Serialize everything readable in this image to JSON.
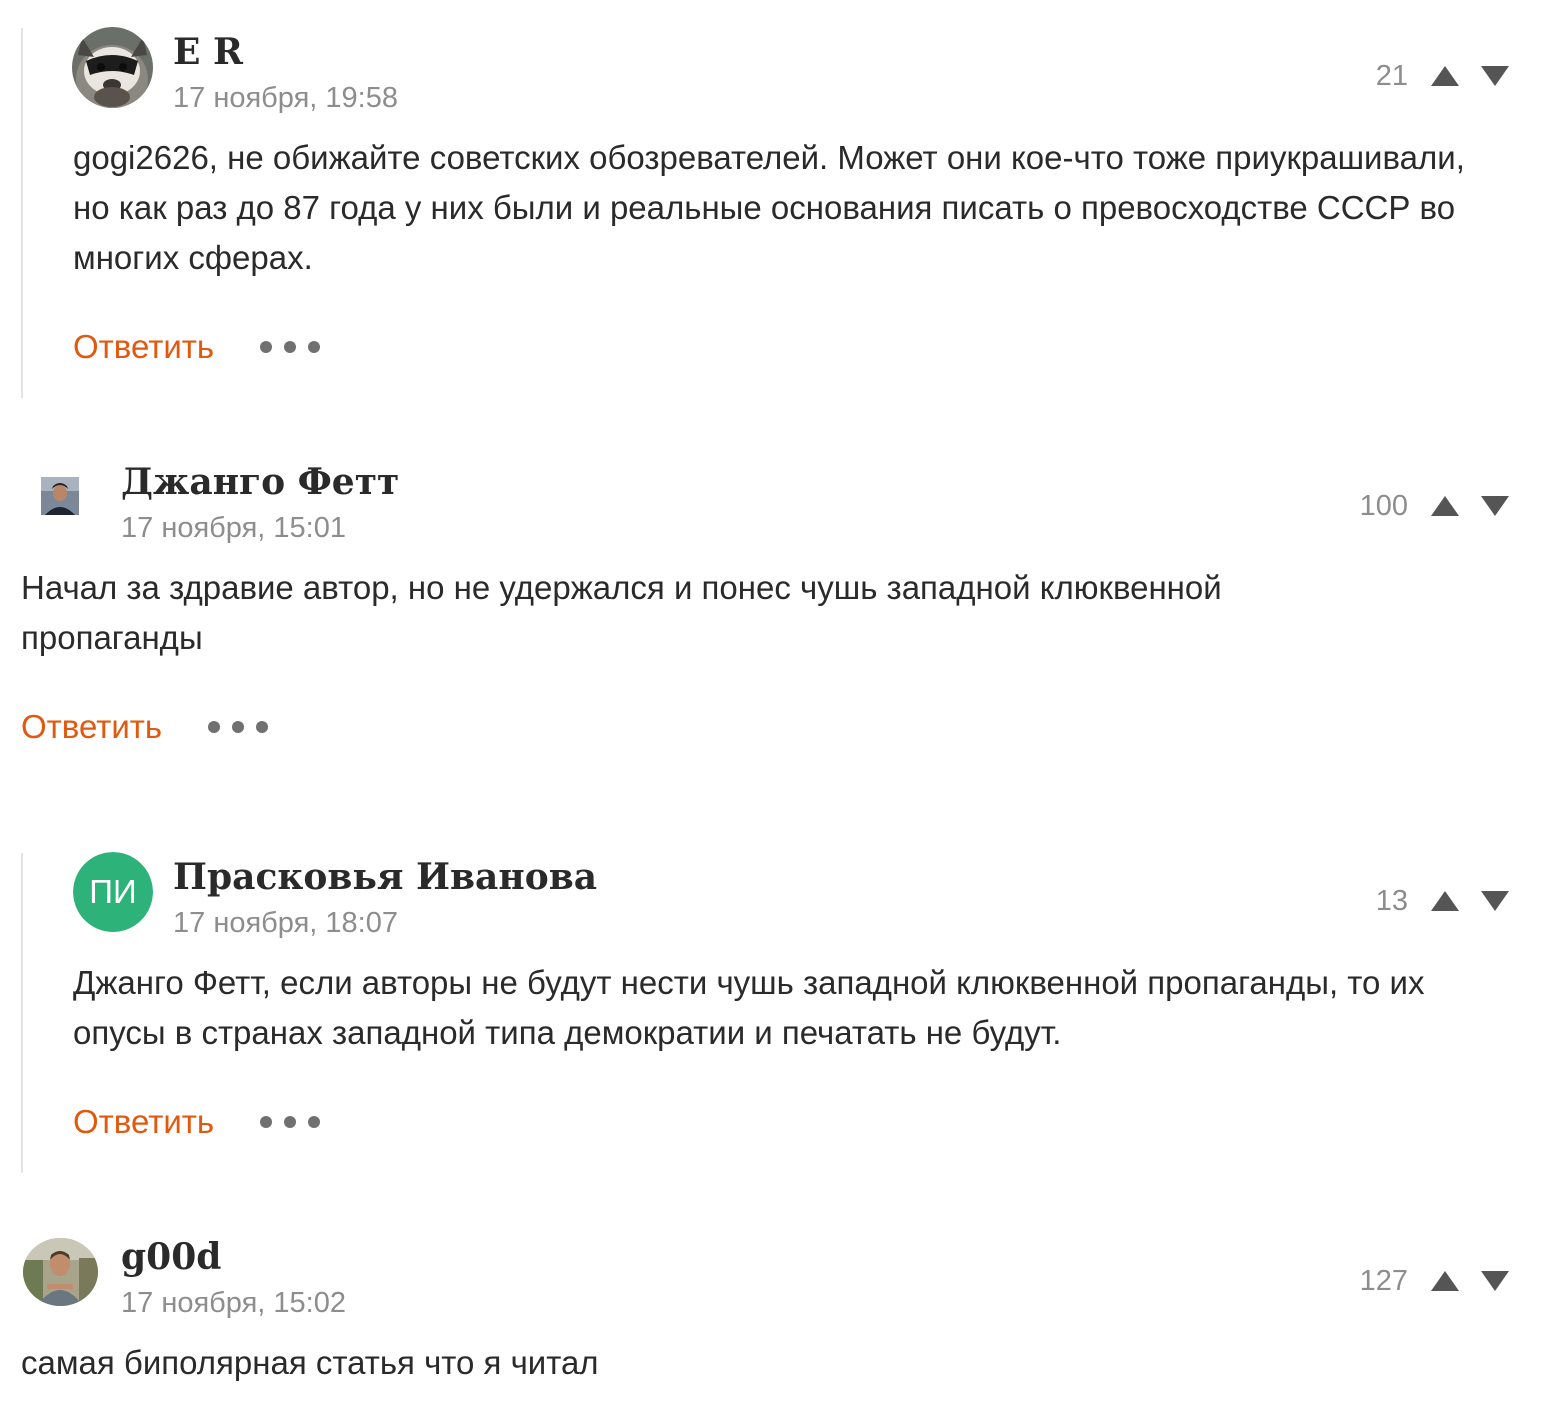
{
  "comments": [
    {
      "author": "E R",
      "date": "17 ноября, 19:58",
      "score": "21",
      "text": "gogi2626, не обижайте советских обозревателей. Может они кое-что тоже приукрашивали, но как раз до 87 года у них были и реальные основания писать о превосходстве СССР во многих сферах.",
      "reply_label": "Ответить",
      "avatar_icon": "raccoon-photo-avatar"
    },
    {
      "author": "Джанго Фетт",
      "date": "17 ноября, 15:01",
      "score": "100",
      "text": "Начал за здравие автор, но не удержался и понес чушь западной клюквенной пропаганды",
      "reply_label": "Ответить",
      "avatar_icon": "man-photo-avatar"
    },
    {
      "author": "Прасковья Иванова",
      "date": "17 ноября, 18:07",
      "score": "13",
      "text": "Джанго Фетт, если авторы не будут нести чушь западной клюквенной пропаганды, то их опусы в странах западной типа демократии и печатать не будут.",
      "reply_label": "Ответить",
      "avatar_initials": "ПИ",
      "avatar_color": "#2db37a"
    },
    {
      "author": "g00d",
      "date": "17 ноября, 15:02",
      "score": "127",
      "text": "самая биполярная статья что я читал",
      "avatar_icon": "man-outdoor-photo-avatar"
    }
  ],
  "colors": {
    "accent": "#e1590f",
    "muted": "#8d8d8d",
    "vote_arrow": "#555555"
  }
}
